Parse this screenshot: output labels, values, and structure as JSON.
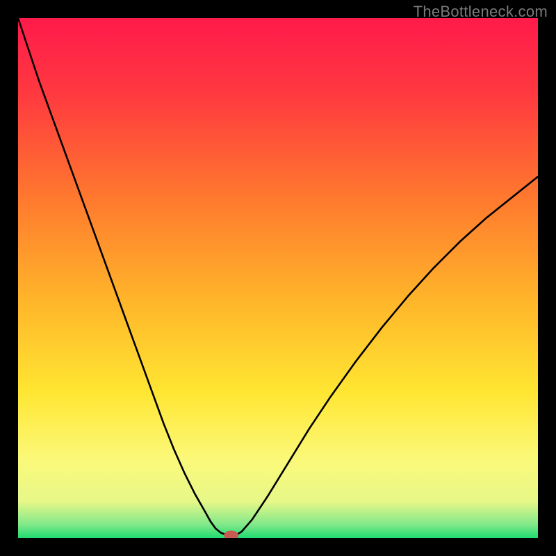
{
  "watermark": "TheBottleneck.com",
  "chart_data": {
    "type": "line",
    "title": "",
    "xlabel": "",
    "ylabel": "",
    "xlim": [
      0,
      100
    ],
    "ylim": [
      0,
      100
    ],
    "background_gradient": {
      "stops": [
        {
          "offset": 0.0,
          "color": "#ff1a4b"
        },
        {
          "offset": 0.15,
          "color": "#ff3a3f"
        },
        {
          "offset": 0.35,
          "color": "#ff7a2e"
        },
        {
          "offset": 0.55,
          "color": "#ffb72a"
        },
        {
          "offset": 0.72,
          "color": "#ffe632"
        },
        {
          "offset": 0.85,
          "color": "#fbf97a"
        },
        {
          "offset": 0.93,
          "color": "#e7f888"
        },
        {
          "offset": 0.975,
          "color": "#7fe88a"
        },
        {
          "offset": 1.0,
          "color": "#1fdc70"
        }
      ]
    },
    "series": [
      {
        "name": "bottleneck-curve",
        "color": "#000000",
        "x": [
          0,
          2,
          4,
          6,
          8,
          10,
          12,
          14,
          16,
          18,
          20,
          22,
          24,
          26,
          28,
          30,
          32,
          34,
          36,
          37,
          38,
          39,
          40,
          41,
          42,
          43,
          45,
          48,
          52,
          56,
          60,
          65,
          70,
          75,
          80,
          85,
          90,
          95,
          100
        ],
        "y": [
          100,
          94,
          88,
          82.5,
          77,
          71.5,
          66,
          60.5,
          55,
          49.5,
          44,
          38.5,
          33,
          27.5,
          22,
          17,
          12.5,
          8.5,
          5,
          3.2,
          1.8,
          1.0,
          0.6,
          0.5,
          0.6,
          1.2,
          3.5,
          8,
          14.5,
          21,
          27,
          34,
          40.5,
          46.5,
          52,
          57,
          61.5,
          65.5,
          69.5
        ]
      }
    ],
    "marker": {
      "name": "optimal-point",
      "x": 41,
      "y": 0.5,
      "rx": 1.4,
      "ry": 0.9,
      "color": "#c85a54"
    }
  }
}
